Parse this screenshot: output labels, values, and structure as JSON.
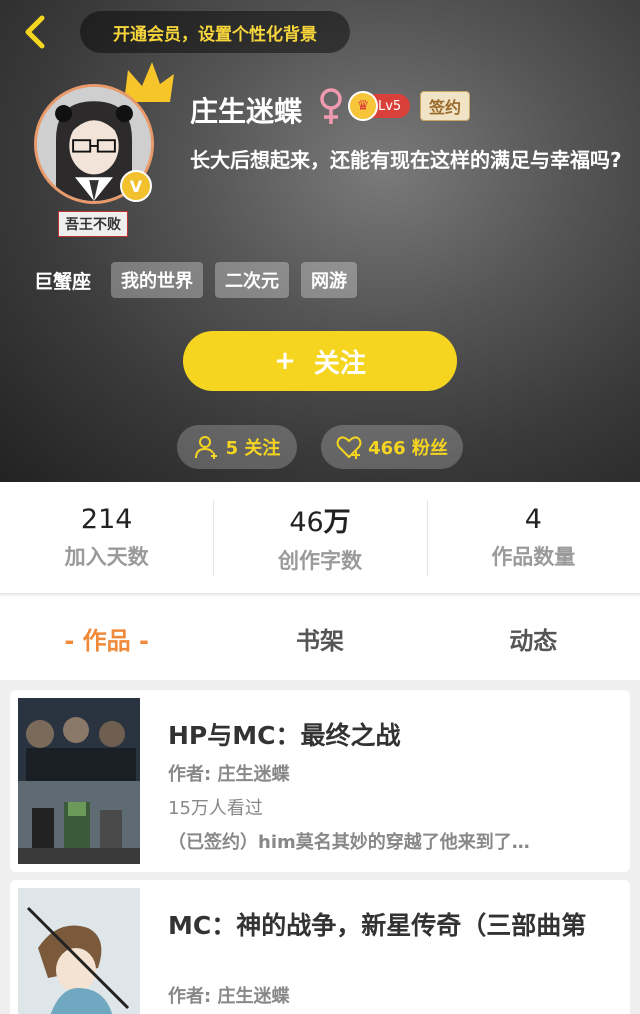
{
  "header": {
    "vip_banner": "开通会员，设置个性化背景",
    "username": "庄生迷蝶",
    "level": "Lv5",
    "signed": "签约",
    "bio": "长大后想起来，还能有现在这样的满足与幸福吗?",
    "title_tag": "吾王不败",
    "zodiac": "巨蟹座",
    "tags": [
      "我的世界",
      "二次元",
      "网游"
    ],
    "follow_label": "关注",
    "following": "5 关注",
    "fans": "466 粉丝",
    "accent": "#f5d520"
  },
  "stats": [
    {
      "value": "214",
      "unit": "",
      "label": "加入天数"
    },
    {
      "value": "46",
      "unit": "万",
      "label": "创作字数"
    },
    {
      "value": "4",
      "unit": "",
      "label": "作品数量"
    }
  ],
  "tabs": [
    {
      "label": "- 作品 -"
    },
    {
      "label": "书架"
    },
    {
      "label": "动态"
    }
  ],
  "works": [
    {
      "title": "HP与MC：最终之战",
      "author": "作者: 庄生迷蝶",
      "views": "15万人看过",
      "desc": "（已签约）him莫名其妙的穿越了他来到了…"
    },
    {
      "title": "MC：神的战争，新星传奇（三部曲第",
      "author": "作者: 庄生迷蝶"
    }
  ]
}
